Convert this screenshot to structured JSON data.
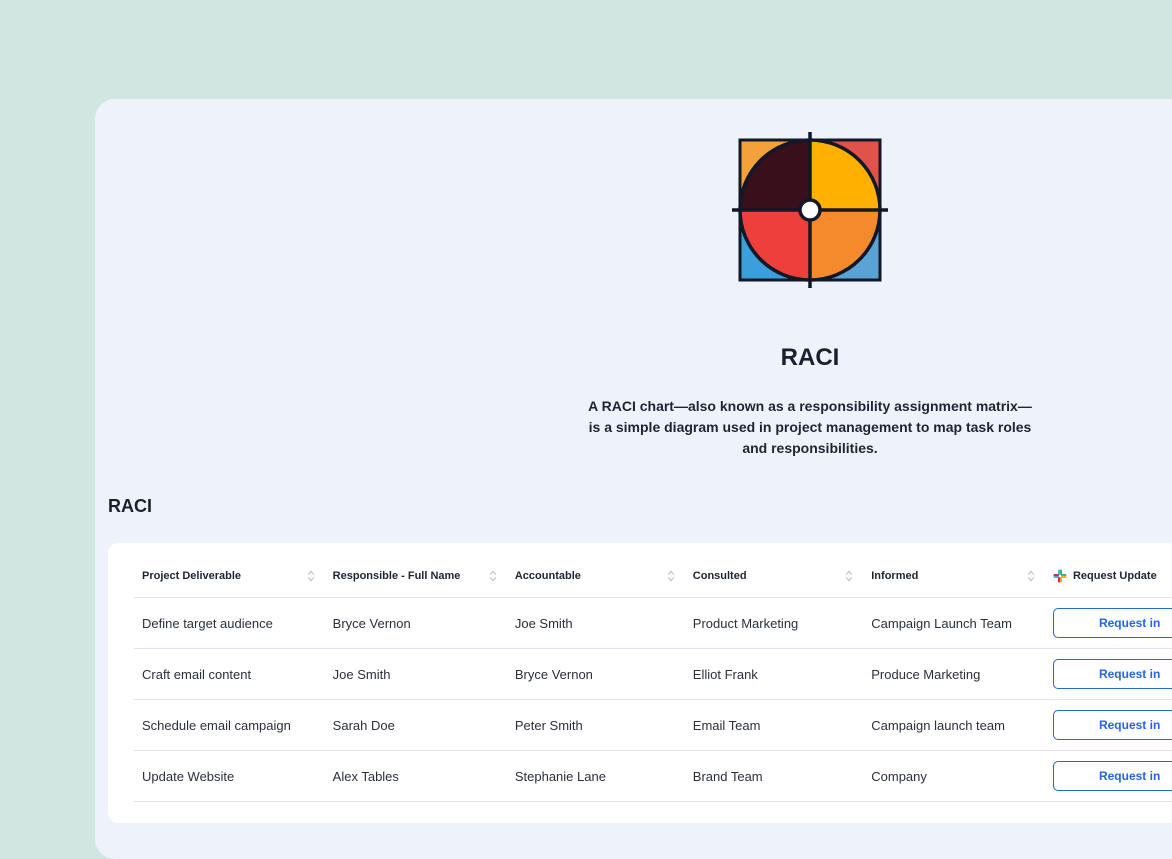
{
  "hero": {
    "title": "RACI",
    "description": "A RACI chart—also known as a responsibility assignment matrix—is a simple diagram used in project management to map task roles and responsibilities."
  },
  "section": {
    "title": "RACI"
  },
  "table": {
    "columns": [
      "Project Deliverable",
      "Responsible - Full Name",
      "Accountable",
      "Consulted",
      "Informed",
      "Request Update"
    ],
    "rows": [
      {
        "deliverable": "Define target audience",
        "responsible": "Bryce Vernon",
        "accountable": "Joe Smith",
        "consulted": "Product Marketing",
        "informed": "Campaign Launch Team",
        "action": "Request in"
      },
      {
        "deliverable": "Craft email content",
        "responsible": "Joe Smith",
        "accountable": "Bryce Vernon",
        "consulted": "Elliot Frank",
        "informed": "Produce Marketing",
        "action": "Request in"
      },
      {
        "deliverable": "Schedule email campaign",
        "responsible": "Sarah Doe",
        "accountable": "Peter Smith",
        "consulted": "Email Team",
        "informed": "Campaign launch team",
        "action": "Request in"
      },
      {
        "deliverable": "Update Website",
        "responsible": "Alex Tables",
        "accountable": "Stephanie Lane",
        "consulted": "Brand Team",
        "informed": "Company",
        "action": "Request in"
      }
    ]
  },
  "colors": {
    "background": "#d1e5e1",
    "panel": "#eef2fb",
    "accent": "#2563eb",
    "text": "#1b2030"
  },
  "icons": {
    "logo": "raci-crosshair-logo",
    "sort": "sort-icon",
    "slack": "slack-icon"
  }
}
